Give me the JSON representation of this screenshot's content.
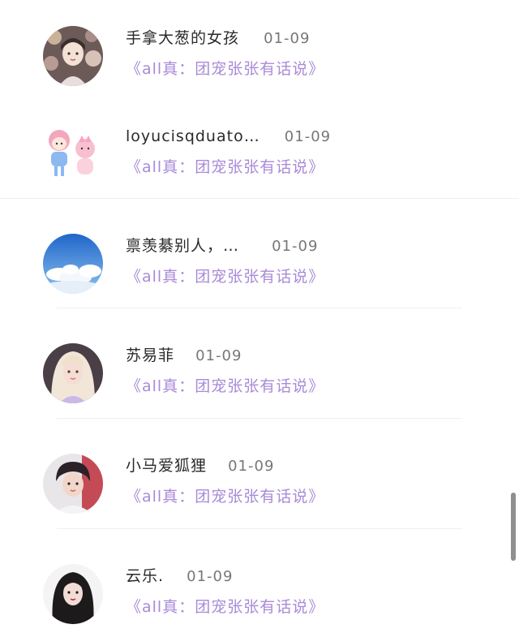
{
  "items": [
    {
      "name": "手拿大葱的女孩",
      "date": "01-09",
      "message": "《all真：团宠张张有话说》",
      "avatar": "avatar-girl-floral"
    },
    {
      "name": "loyucisqduato…",
      "date": "01-09",
      "message": "《all真：团宠张张有话说》",
      "avatar": "avatar-cartoon-couple"
    },
    {
      "name": "禀羡綦别人，…",
      "date": "01-09",
      "message": "《all真：团宠张张有话说》",
      "avatar": "avatar-blue-sky"
    },
    {
      "name": "苏易菲",
      "date": "01-09",
      "message": "《all真：团宠张张有话说》",
      "avatar": "avatar-blonde-girl"
    },
    {
      "name": "小马爱狐狸",
      "date": "01-09",
      "message": "《all真：团宠张张有话说》",
      "avatar": "avatar-boy"
    },
    {
      "name": "云乐.",
      "date": "01-09",
      "message": "《all真：团宠张张有话说》",
      "avatar": "avatar-dark-hair-girl"
    }
  ],
  "colors": {
    "name": "#2a2a2a",
    "date": "#777777",
    "message": "#a98ad8",
    "divider": "#f0f0f2",
    "scrollbar": "#8f8f8f"
  }
}
